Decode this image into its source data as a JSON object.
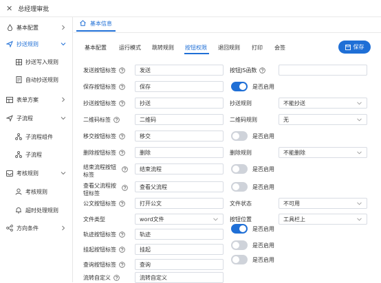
{
  "window": {
    "title": "总经理审批"
  },
  "sidebar": {
    "items": [
      {
        "label": "基本配置"
      },
      {
        "label": "抄送规则"
      },
      {
        "label": "抄送写入规则"
      },
      {
        "label": "自动抄送规则"
      },
      {
        "label": "表单方案"
      },
      {
        "label": "子流程"
      },
      {
        "label": "子流程组件"
      },
      {
        "label": "子流程"
      },
      {
        "label": "考核规则"
      },
      {
        "label": "考核规则"
      },
      {
        "label": "超时处理规则"
      },
      {
        "label": "方向条件"
      }
    ]
  },
  "main": {
    "page_tab": "基本信息",
    "tabs": [
      "基本配置",
      "运行模式",
      "跳转规则",
      "按钮权限",
      "退回规则",
      "打印",
      "会签"
    ],
    "active_tab": "按钮权限",
    "save_label": "保存",
    "accent": "#1f6fd6"
  },
  "form": {
    "send_label": "发送按钮标签",
    "send_value": "发送",
    "batch_label": "按钮JS函数",
    "batch_value": "",
    "save_label": "保存按钮标签",
    "save_value": "保存",
    "save_enabled_label": "是否启用",
    "save_enabled": true,
    "cc_label": "抄送按钮标签",
    "cc_value": "抄送",
    "cc_rule_label": "抄送规则",
    "cc_rule_value": "不能抄送",
    "qr_label": "二维码标签",
    "qr_value": "二维码",
    "qr_rule_label": "二维码规则",
    "qr_rule_value": "无",
    "shift_label": "移交按钮标签",
    "shift_value": "移交",
    "shift_enabled_label": "是否启用",
    "shift_enabled": false,
    "delete_label": "删除按钮标签",
    "delete_value": "删除",
    "delete_rule_label": "删除规则",
    "delete_rule_value": "不能删除",
    "end_label_1": "结束流程按钮",
    "end_label_2": "标签",
    "end_value": "结束流程",
    "end_enabled_label": "是否启用",
    "end_enabled": false,
    "parent_label_1": "查看父流程按",
    "parent_label_2": "钮标签",
    "parent_value": "查看父流程",
    "parent_enabled_label": "是否启用",
    "parent_enabled": false,
    "doc_label": "公文按钮标签",
    "doc_value": "打开公文",
    "doc_status_label": "文件状态",
    "doc_status_value": "不可用",
    "filetype_label": "文件类型",
    "filetype_value": "word文件",
    "btnpos_label": "按钮位置",
    "btnpos_value": "工具栏上",
    "track_label": "轨迹按钮标签",
    "track_value": "轨迹",
    "track_enabled_label": "是否启用",
    "track_enabled": true,
    "hang_label": "挂起按钮标签",
    "hang_value": "挂起",
    "hang_enabled_label": "是否启用",
    "hang_enabled": false,
    "query_label": "查询按钮标签",
    "query_value": "查询",
    "query_enabled_label": "是否启用",
    "query_enabled": false,
    "custom_label": "流转自定义",
    "custom_value": "流转自定义"
  }
}
